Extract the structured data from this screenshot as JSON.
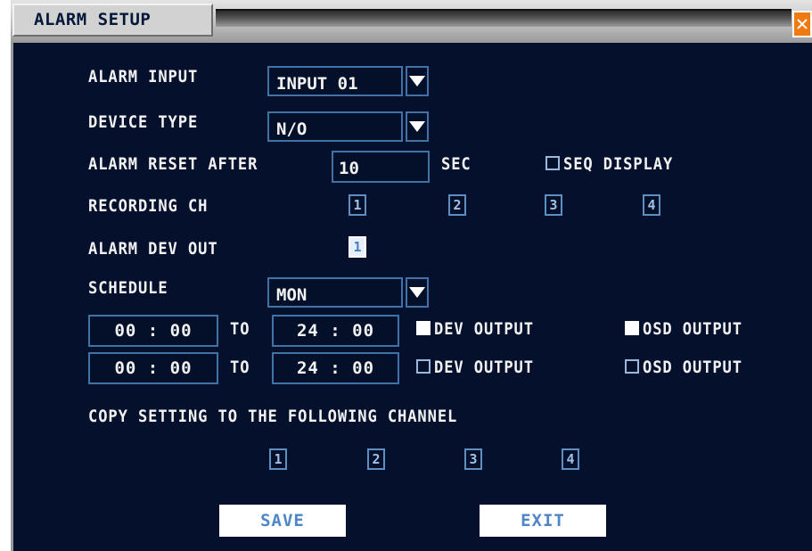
{
  "window": {
    "title": "ALARM SETUP",
    "close_glyph": "✕"
  },
  "alarm_input": {
    "label": "ALARM INPUT",
    "value": "INPUT 01"
  },
  "device_type": {
    "label": "DEVICE TYPE",
    "value": "N/O"
  },
  "alarm_reset": {
    "label": "ALARM RESET AFTER",
    "value": "10",
    "unit": "SEC"
  },
  "seq_display": {
    "label": "SEQ DISPLAY",
    "checked": false
  },
  "recording_ch": {
    "label": "RECORDING CH",
    "channels": [
      "1",
      "2",
      "3",
      "4"
    ],
    "selected": []
  },
  "alarm_dev_out": {
    "label": "ALARM DEV OUT",
    "channels": [
      "1"
    ],
    "selected": [
      "1"
    ]
  },
  "schedule": {
    "label": "SCHEDULE",
    "day": "MON",
    "rows": [
      {
        "from": "00 : 00",
        "to_label": "TO",
        "to": "24 : 00",
        "dev_output_label": "DEV OUTPUT",
        "dev_output": true,
        "osd_output_label": "OSD OUTPUT",
        "osd_output": true
      },
      {
        "from": "00 : 00",
        "to_label": "TO",
        "to": "24 : 00",
        "dev_output_label": "DEV OUTPUT",
        "dev_output": false,
        "osd_output_label": "OSD OUTPUT",
        "osd_output": false
      }
    ]
  },
  "copy_setting": {
    "label": "COPY SETTING TO THE FOLLOWING CHANNEL",
    "channels": [
      "1",
      "2",
      "3",
      "4"
    ]
  },
  "buttons": {
    "save": "SAVE",
    "exit": "EXIT"
  },
  "colors": {
    "background": "#05112c",
    "field_border": "#3f73a8",
    "close": "#f07a12",
    "button_text": "#4e86c7"
  },
  "icons": {
    "dropdown": "triangle-down-icon",
    "close": "close-icon"
  }
}
